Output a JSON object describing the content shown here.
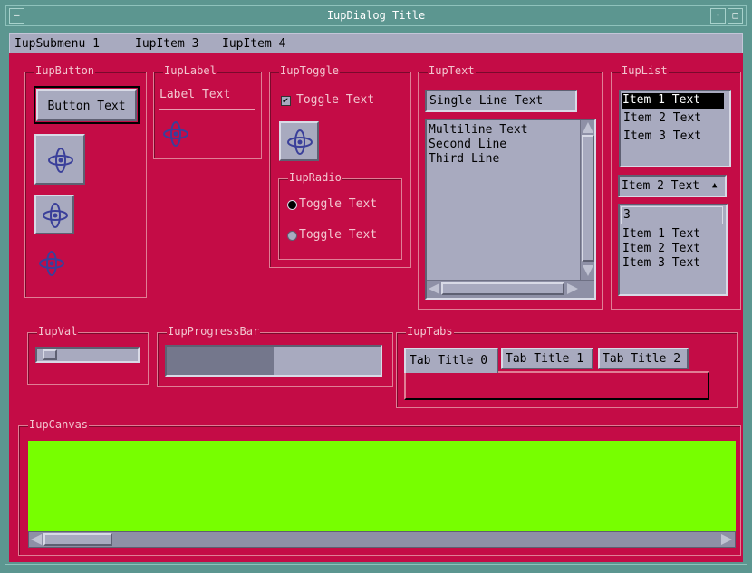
{
  "window": {
    "title": "IupDialog Title"
  },
  "menu": {
    "items": [
      "IupSubmenu 1",
      "IupItem 3",
      "IupItem 4"
    ]
  },
  "groups": {
    "button": "IupButton",
    "label": "IupLabel",
    "toggle": "IupToggle",
    "radio": "IupRadio",
    "text": "IupText",
    "list": "IupList",
    "val": "IupVal",
    "progress": "IupProgressBar",
    "tabs": "IupTabs",
    "canvas": "IupCanvas"
  },
  "button": {
    "label": "Button Text"
  },
  "label": {
    "text": "Label Text"
  },
  "toggle": {
    "label": "Toggle Text",
    "checked": true
  },
  "radio": {
    "options": [
      "Toggle Text",
      "Toggle Text"
    ],
    "selected_index": 0
  },
  "text": {
    "single_line": "Single Line Text",
    "multiline": [
      "Multiline Text",
      "Second Line",
      "Third Line"
    ]
  },
  "list": {
    "items": [
      "Item 1 Text",
      "Item 2 Text",
      "Item 3 Text"
    ],
    "selected_index": 0,
    "dropdown_value": "Item 2 Text",
    "edit_value": "3",
    "edit_items": [
      "Item 1 Text",
      "Item 2 Text",
      "Item 3 Text"
    ]
  },
  "val": {
    "value": 0.05
  },
  "progress": {
    "value": 0.5
  },
  "tabs": {
    "titles": [
      "Tab Title 0",
      "Tab Title 1",
      "Tab Title 2"
    ],
    "active_index": 0
  },
  "canvas": {
    "background": "#77ff00"
  },
  "colors": {
    "dialog_bg": "#c40c46",
    "widget_bg": "#a8aabf",
    "frame": "#5c9690"
  },
  "icons": {
    "image": "gimbal-icon"
  }
}
